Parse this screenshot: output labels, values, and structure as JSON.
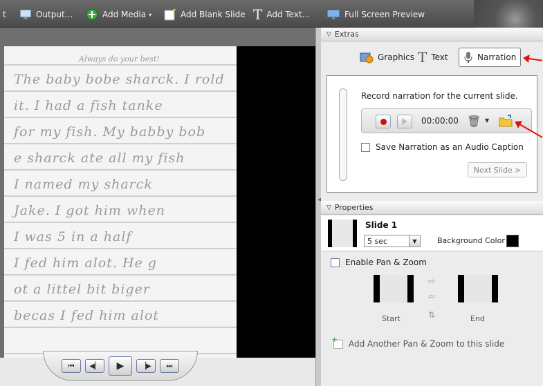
{
  "toolbar": {
    "cut_label": "t",
    "output_label": "Output...",
    "add_media_label": "Add Media",
    "add_blank_slide_label": "Add Blank Slide",
    "add_text_label": "Add Text...",
    "full_screen_label": "Full Screen Preview"
  },
  "slide_preview": {
    "heading": "Always do your best!",
    "lines": [
      "The baby bobe sharck. I rold",
      "it. I had a fish tanke",
      "for my fish. My babby bob",
      "e sharck ate all my fish",
      "I named my sharck",
      "Jake. I got him when",
      "I was 5 in a half",
      "I fed him alot. He g",
      "ot a littel bit biger",
      "becas I fed him alot"
    ]
  },
  "extras": {
    "section_title": "Extras",
    "tabs": [
      {
        "label": "Graphics",
        "icon": "graphics-icon"
      },
      {
        "label": "Text",
        "icon": "text-icon"
      },
      {
        "label": "Narration",
        "icon": "microphone-icon",
        "active": true
      }
    ],
    "narration": {
      "instruction": "Record narration for the current slide.",
      "timer": "00:00:00",
      "save_caption_label": "Save Narration as an Audio Caption",
      "save_caption_checked": false,
      "next_slide_label": "Next Slide >"
    }
  },
  "properties": {
    "section_title": "Properties",
    "slide_name": "Slide 1",
    "duration": "5 sec",
    "background_color_label": "Background Color",
    "background_color": "#000000"
  },
  "pan_zoom": {
    "enable_label": "Enable Pan & Zoom",
    "enabled": false,
    "start_label": "Start",
    "end_label": "End",
    "add_label": "Add Another Pan & Zoom to this slide"
  },
  "colors": {
    "toolbar_bg": "#555555",
    "accent_red": "#e01010",
    "record_red": "#c81010"
  }
}
